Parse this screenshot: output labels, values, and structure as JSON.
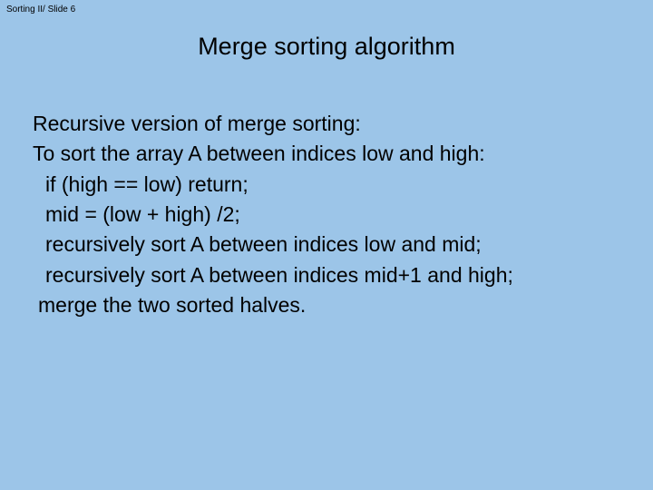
{
  "header": "Sorting II/ Slide 6",
  "title": "Merge sorting algorithm",
  "lines": [
    "Recursive version of merge sorting:",
    "To sort the array A between indices low and high:",
    "if (high == low) return;",
    "mid = (low + high) /2;",
    "recursively sort A between indices low and mid;",
    "recursively sort A between indices mid+1 and high;",
    "merge the two sorted halves."
  ]
}
